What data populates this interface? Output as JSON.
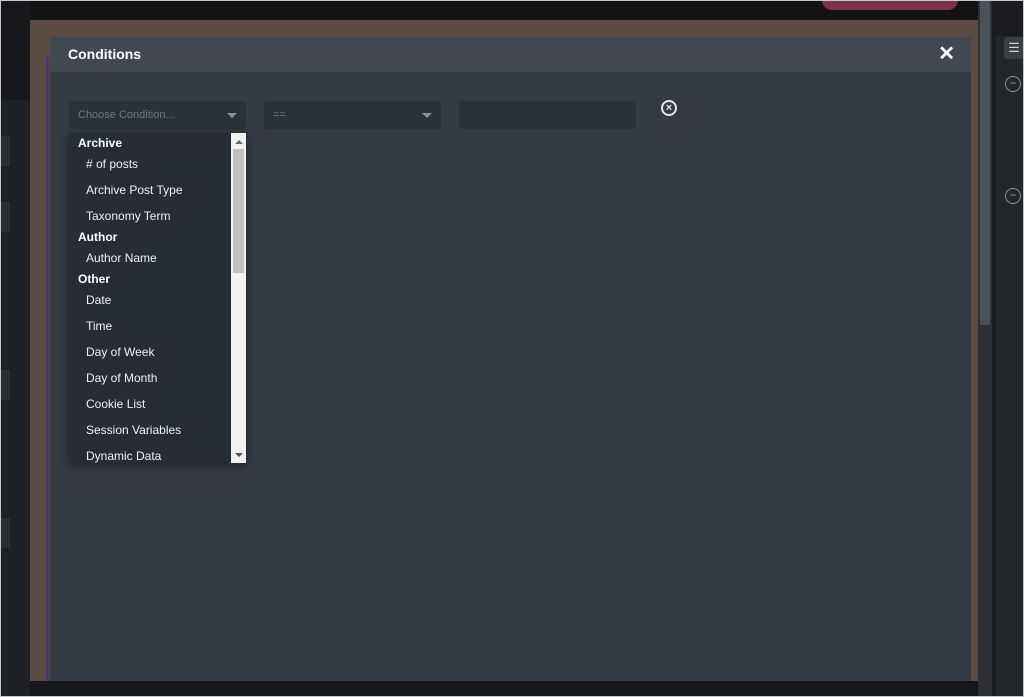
{
  "modal": {
    "title": "Conditions",
    "close_icon": "close-icon"
  },
  "condition_row": {
    "condition_select": {
      "placeholder": "Choose Condition..."
    },
    "operator_select": {
      "value": "=="
    },
    "value_input": {
      "value": ""
    },
    "remove_icon": "remove-circle-icon"
  },
  "dropdown": {
    "groups": [
      {
        "label": "Archive",
        "items": [
          "# of posts",
          "Archive Post Type",
          "Taxonomy Term"
        ]
      },
      {
        "label": "Author",
        "items": [
          "Author Name"
        ]
      },
      {
        "label": "Other",
        "items": [
          "Date",
          "Time",
          "Day of Week",
          "Day of Month",
          "Cookie List",
          "Session Variables",
          "Dynamic Data"
        ]
      }
    ]
  },
  "colors": {
    "modal_bg": "#343b43",
    "header_bg": "#404850",
    "dropdown_bg": "#262d34",
    "backdrop_brown": "#5b4b45",
    "accent_pink": "#7a3348"
  }
}
